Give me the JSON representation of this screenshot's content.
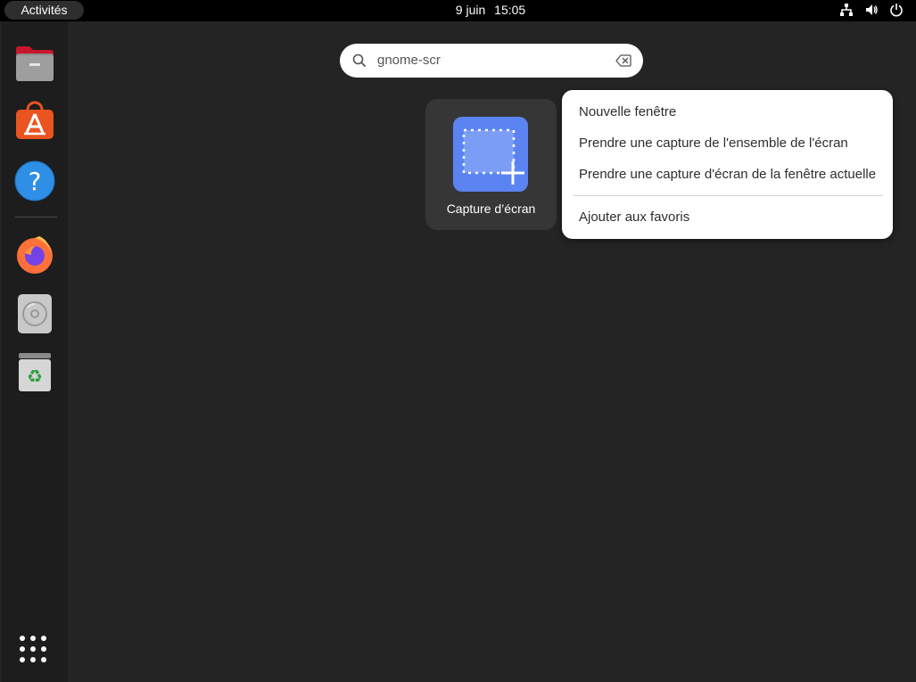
{
  "topbar": {
    "activities_label": "Activités",
    "date": "9 juin",
    "time": "15:05",
    "tray_icons": [
      "network-icon",
      "volume-icon",
      "power-icon"
    ]
  },
  "dock": {
    "items": [
      {
        "name": "files-icon"
      },
      {
        "name": "app-center-icon"
      },
      {
        "name": "help-icon"
      },
      {
        "name": "firefox-icon"
      },
      {
        "name": "disc-icon"
      },
      {
        "name": "trash-icon"
      }
    ],
    "show_apps_icon": "grid-icon"
  },
  "search": {
    "value": "gnome-scr"
  },
  "results": [
    {
      "label": "Capture d’écran",
      "icon": "screenshot-app-icon"
    }
  ],
  "context_menu": {
    "items": [
      "Nouvelle fenêtre",
      "Prendre une capture de l'ensemble de l'écran",
      "Prendre une capture d'écran de la fenêtre actuelle"
    ],
    "favorite": "Ajouter aux favoris"
  },
  "colors": {
    "background": "#242424",
    "dock": "#1d1d1d",
    "accent_orange": "#e95420",
    "screenshot_blue": "#5b84f2"
  }
}
